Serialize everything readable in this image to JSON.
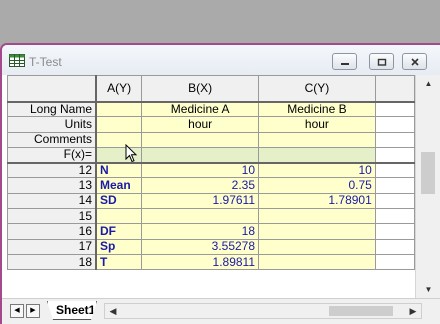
{
  "window": {
    "title": "T-Test"
  },
  "columns": {
    "row_header": "",
    "a": "A(Y)",
    "b": "B(X)",
    "c": "C(Y)"
  },
  "meta_rows": [
    {
      "label": "Long Name",
      "a": "",
      "b": "Medicine A",
      "c": "Medicine B"
    },
    {
      "label": "Units",
      "a": "",
      "b": "hour",
      "c": "hour"
    },
    {
      "label": "Comments",
      "a": "",
      "b": "",
      "c": ""
    },
    {
      "label": "F(x)=",
      "a": "",
      "b": "",
      "c": ""
    }
  ],
  "data_rows": [
    {
      "row": "12",
      "a": "N",
      "b": "10",
      "c": "10"
    },
    {
      "row": "13",
      "a": "Mean",
      "b": "2.35",
      "c": "0.75"
    },
    {
      "row": "14",
      "a": "SD",
      "b": "1.97611",
      "c": "1.78901"
    },
    {
      "row": "15",
      "a": "",
      "b": "",
      "c": ""
    },
    {
      "row": "16",
      "a": "DF",
      "b": "18",
      "c": ""
    },
    {
      "row": "17",
      "a": "Sp",
      "b": "3.55278",
      "c": ""
    },
    {
      "row": "18",
      "a": "T",
      "b": "1.89811",
      "c": ""
    }
  ],
  "sheet_tab": {
    "label": "Sheet1"
  },
  "icons": {
    "app": "worksheet-icon",
    "minimize": "minimize-icon",
    "restore": "restore-icon",
    "close": "close-icon"
  },
  "colors": {
    "window_border": "#a24a8c",
    "cell_bg": "#ffffcc",
    "value_text": "#1a1aa8"
  }
}
